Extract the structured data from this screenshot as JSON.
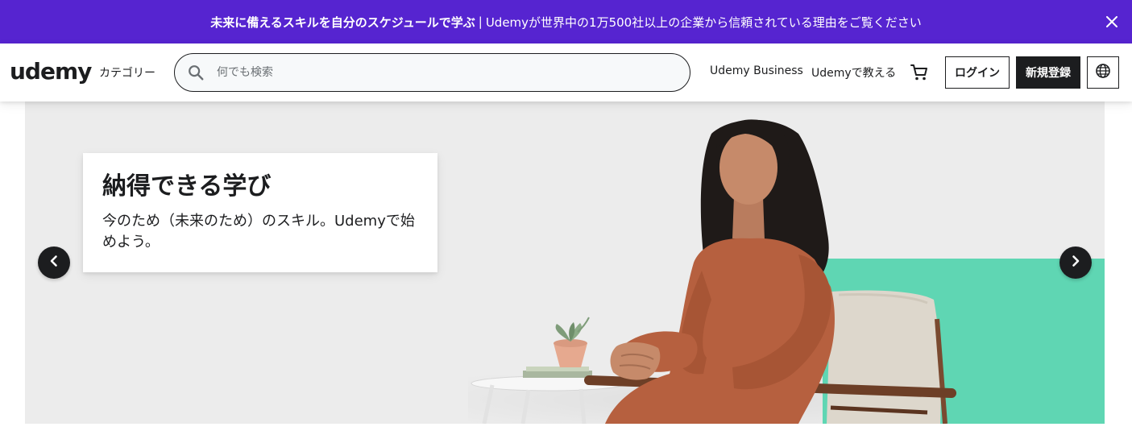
{
  "banner": {
    "strong_text": "未来に備えるスキルを自分のスケジュールで学ぶ",
    "separator": "|",
    "link_text": "Udemyが世界中の1万500社以上の企業から信頼されている理由をご覧ください",
    "close_icon": "close-icon",
    "background": "#5624d0"
  },
  "header": {
    "logo_text": "udemy",
    "categories_label": "カテゴリー",
    "search": {
      "placeholder": "何でも検索",
      "value": "",
      "icon": "search-icon"
    },
    "business_link": "Udemy Business",
    "teach_link": "Udemyで教える",
    "cart_icon": "cart-icon",
    "login_label": "ログイン",
    "signup_label": "新規登録",
    "language_icon": "globe-icon"
  },
  "hero": {
    "title": "納得できる学び",
    "subtitle": "今のため（未来のため）のスキル。Udemyで始めよう。",
    "prev_icon": "chevron-left-icon",
    "next_icon": "chevron-right-icon",
    "accent_color": "#5fd6b3"
  }
}
